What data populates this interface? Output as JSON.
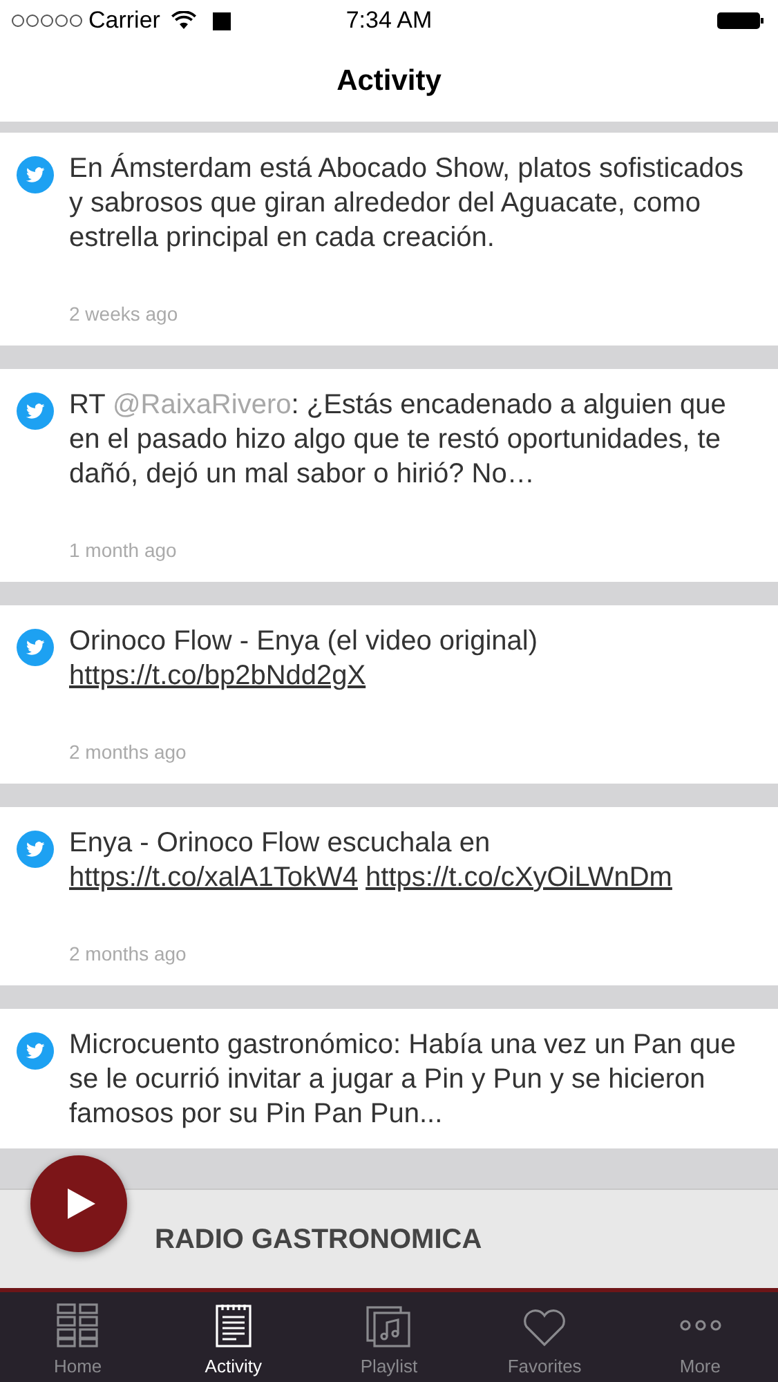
{
  "status_bar": {
    "carrier": "Carrier",
    "time": "7:34 AM"
  },
  "nav": {
    "title": "Activity"
  },
  "tweets": [
    {
      "segments": [
        {
          "kind": "text",
          "text": "En Ámsterdam está Abocado Show, platos sofisticados y sabrosos que giran alrededor del Aguacate, como estrella principal en cada creación."
        }
      ],
      "time": "2 weeks ago"
    },
    {
      "segments": [
        {
          "kind": "text",
          "text": "RT "
        },
        {
          "kind": "mention",
          "text": "@RaixaRivero"
        },
        {
          "kind": "text",
          "text": ": ¿Estás encadenado a alguien que en el pasado hizo algo que te restó oportunidades, te dañó, dejó un mal sabor o hirió? No…"
        }
      ],
      "time": "1 month ago"
    },
    {
      "segments": [
        {
          "kind": "text",
          "text": "Orinoco Flow - Enya (el video original) "
        },
        {
          "kind": "link",
          "text": "https://t.co/bp2bNdd2gX"
        }
      ],
      "time": "2 months ago"
    },
    {
      "segments": [
        {
          "kind": "text",
          "text": "Enya - Orinoco Flow escuchala en "
        },
        {
          "kind": "link",
          "text": "https://t.co/xalA1TokW4"
        },
        {
          "kind": "link",
          "text": "https://t.co/cXyOiLWnDm"
        }
      ],
      "time": "2 months ago"
    },
    {
      "segments": [
        {
          "kind": "text",
          "text": "Microcuento gastronómico: Había una vez un Pan que se le ocurrió invitar a jugar a Pin y Pun y se hicieron famosos por su Pin Pan Pun..."
        }
      ]
    }
  ],
  "player": {
    "station": "RADIO GASTRONOMICA"
  },
  "tabs": [
    {
      "label": "Home",
      "kind": "home",
      "selected": false
    },
    {
      "label": "Activity",
      "kind": "activity",
      "selected": true
    },
    {
      "label": "Playlist",
      "kind": "playlist",
      "selected": false
    },
    {
      "label": "Favorites",
      "kind": "favorites",
      "selected": false
    },
    {
      "label": "More",
      "kind": "more",
      "selected": false
    }
  ]
}
